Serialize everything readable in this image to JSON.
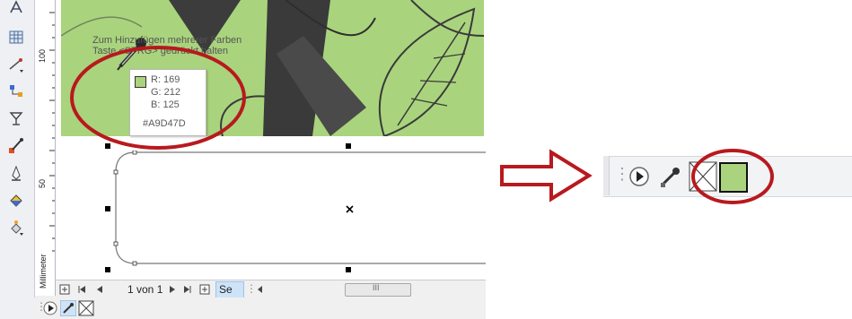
{
  "tooltip": {
    "line1": "Zum Hinzufügen mehrerer Farben",
    "line2": "Taste <STRG> gedrückt halten"
  },
  "color_readout": {
    "swatch_color": "#A9D47D",
    "r": "R: 169",
    "g": "G: 212",
    "b": "B: 125",
    "hex": "#A9D47D"
  },
  "ruler": {
    "label_100": "100",
    "label_50": "50",
    "unit": "Millimeter"
  },
  "status_bar": {
    "page_label": "1 von 1",
    "page_tab": "Se",
    "scroll_grip": "III"
  },
  "colors": {
    "highlight_ring": "#b8191e",
    "arrow": "#b8191e",
    "swatch_green": "#A9D47D"
  },
  "icons": {
    "tools": [
      "text-tool-icon",
      "table-icon",
      "dimension-tool-icon",
      "connector-tool-icon",
      "effects-icon",
      "eyedropper-icon",
      "outline-pen-icon",
      "fill-bucket-icon",
      "interactive-fill-icon"
    ],
    "bottom": [
      "play-icon",
      "eyedropper-icon",
      "no-color-icon"
    ],
    "right": [
      "play-icon",
      "eyedropper-icon",
      "no-color-icon",
      "green-swatch"
    ]
  }
}
